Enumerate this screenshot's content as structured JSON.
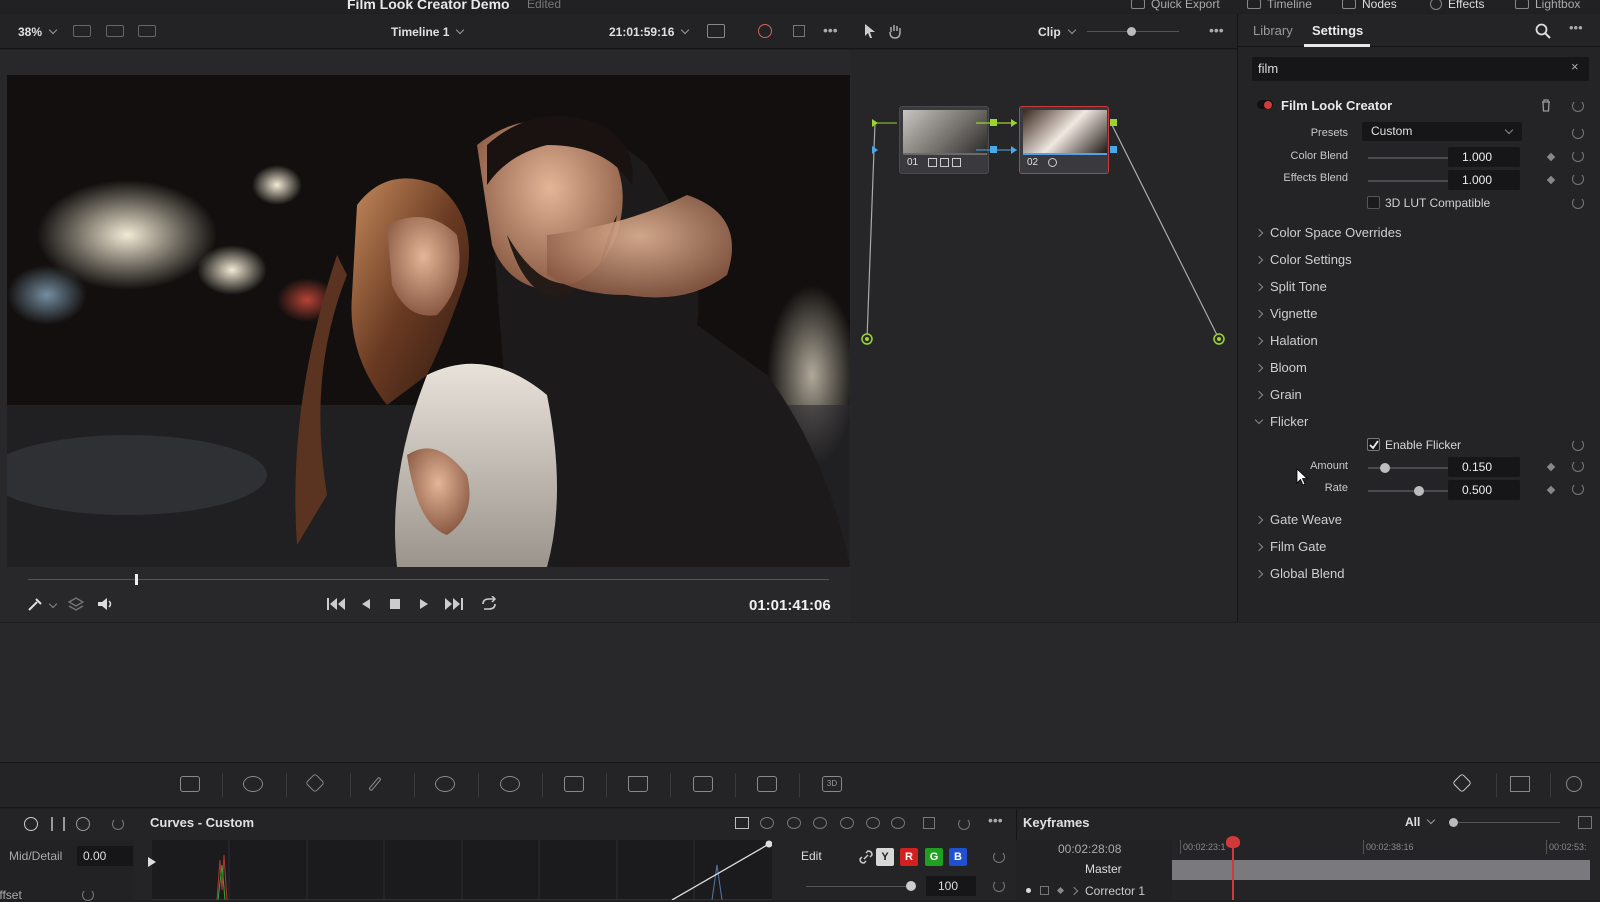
{
  "topbar": {
    "project_title": "Film Look Creator Demo",
    "project_status": "Edited",
    "nav": [
      {
        "label": "Quick Export",
        "icon": "export-icon"
      },
      {
        "label": "Timeline",
        "icon": "timeline-icon"
      },
      {
        "label": "Nodes",
        "icon": "nodes-icon"
      },
      {
        "label": "Effects",
        "icon": "effects-icon"
      },
      {
        "label": "Lightbox",
        "icon": "lightbox-icon"
      }
    ]
  },
  "viewer": {
    "zoom": "38%",
    "timeline_name": "Timeline 1",
    "record_timecode": "21:01:59:16",
    "source_timecode": "01:01:41:06"
  },
  "node_editor": {
    "mode": "Clip",
    "nodes": [
      {
        "label": "01"
      },
      {
        "label": "02"
      }
    ]
  },
  "settings_panel": {
    "tabs": [
      "Library",
      "Settings"
    ],
    "active_tab": "Settings",
    "search_value": "film",
    "effect_title": "Film Look Creator",
    "presets_label": "Presets",
    "presets_value": "Custom",
    "color_blend_label": "Color Blend",
    "color_blend_value": "1.000",
    "effects_blend_label": "Effects Blend",
    "effects_blend_value": "1.000",
    "lut_label": "3D LUT Compatible",
    "sections": [
      "Color Space Overrides",
      "Color Settings",
      "Split Tone",
      "Vignette",
      "Halation",
      "Bloom",
      "Grain"
    ],
    "flicker": {
      "title": "Flicker",
      "enable_label": "Enable Flicker",
      "enabled": true,
      "amount_label": "Amount",
      "amount_value": "0.150",
      "rate_label": "Rate",
      "rate_value": "0.500"
    },
    "sections_after": [
      "Gate Weave",
      "Film Gate",
      "Global Blend"
    ]
  },
  "curves": {
    "title": "Curves - Custom",
    "mid_detail_label": "Mid/Detail",
    "mid_detail_value": "0.00",
    "offset_label": "Offset",
    "edit_label": "Edit",
    "channels": [
      "Y",
      "R",
      "G",
      "B"
    ],
    "intensity_value": "100"
  },
  "keyframes": {
    "title": "Keyframes",
    "filter": "All",
    "current_timecode": "00:02:28:08",
    "ruler": [
      "00:02:23:1",
      "00:02:38:16",
      "00:02:53:"
    ],
    "tracks": [
      "Master",
      "Corrector 1"
    ]
  },
  "colors": {
    "accent_red": "#d03a3a",
    "node_link_green": "#9bd432",
    "node_link_blue": "#4aa8e8"
  }
}
